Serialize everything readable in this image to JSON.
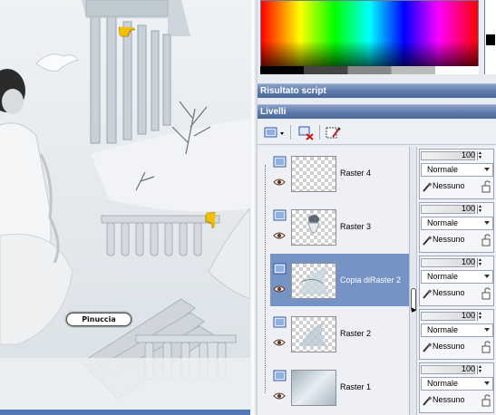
{
  "canvas": {
    "watermark": "Pinuccia",
    "pointer_icon": "pointing-hand-icon"
  },
  "panel": {
    "script_result_title": "Risultato script",
    "layers_title": "Livelli",
    "toolbar": {
      "new_layer_icon": "new-layer-icon",
      "delete_layer_icon": "delete-layer-icon",
      "properties_icon": "layer-properties-icon"
    },
    "layers": [
      {
        "name": "Raster 4",
        "opacity": "100",
        "blend": "Normale",
        "mask": "Nessuno",
        "selected": false
      },
      {
        "name": "Raster 3",
        "opacity": "100",
        "blend": "Normale",
        "mask": "Nessuno",
        "selected": false
      },
      {
        "name": "Copia diRaster 2",
        "opacity": "100",
        "blend": "Normale",
        "mask": "Nessuno",
        "selected": true
      },
      {
        "name": "Raster 2",
        "opacity": "100",
        "blend": "Normale",
        "mask": "Nessuno",
        "selected": false
      },
      {
        "name": "Raster 1",
        "opacity": "100",
        "blend": "Normale",
        "mask": "Nessuno",
        "selected": false
      }
    ]
  }
}
